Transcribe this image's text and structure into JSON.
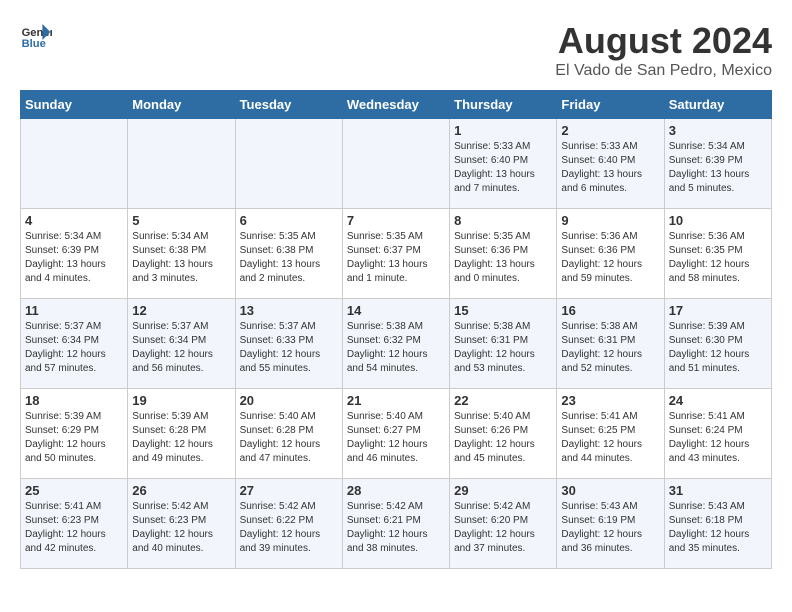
{
  "header": {
    "logo_general": "General",
    "logo_blue": "Blue",
    "month_year": "August 2024",
    "location": "El Vado de San Pedro, Mexico"
  },
  "weekdays": [
    "Sunday",
    "Monday",
    "Tuesday",
    "Wednesday",
    "Thursday",
    "Friday",
    "Saturday"
  ],
  "weeks": [
    [
      {
        "day": "",
        "info": ""
      },
      {
        "day": "",
        "info": ""
      },
      {
        "day": "",
        "info": ""
      },
      {
        "day": "",
        "info": ""
      },
      {
        "day": "1",
        "info": "Sunrise: 5:33 AM\nSunset: 6:40 PM\nDaylight: 13 hours\nand 7 minutes."
      },
      {
        "day": "2",
        "info": "Sunrise: 5:33 AM\nSunset: 6:40 PM\nDaylight: 13 hours\nand 6 minutes."
      },
      {
        "day": "3",
        "info": "Sunrise: 5:34 AM\nSunset: 6:39 PM\nDaylight: 13 hours\nand 5 minutes."
      }
    ],
    [
      {
        "day": "4",
        "info": "Sunrise: 5:34 AM\nSunset: 6:39 PM\nDaylight: 13 hours\nand 4 minutes."
      },
      {
        "day": "5",
        "info": "Sunrise: 5:34 AM\nSunset: 6:38 PM\nDaylight: 13 hours\nand 3 minutes."
      },
      {
        "day": "6",
        "info": "Sunrise: 5:35 AM\nSunset: 6:38 PM\nDaylight: 13 hours\nand 2 minutes."
      },
      {
        "day": "7",
        "info": "Sunrise: 5:35 AM\nSunset: 6:37 PM\nDaylight: 13 hours\nand 1 minute."
      },
      {
        "day": "8",
        "info": "Sunrise: 5:35 AM\nSunset: 6:36 PM\nDaylight: 13 hours\nand 0 minutes."
      },
      {
        "day": "9",
        "info": "Sunrise: 5:36 AM\nSunset: 6:36 PM\nDaylight: 12 hours\nand 59 minutes."
      },
      {
        "day": "10",
        "info": "Sunrise: 5:36 AM\nSunset: 6:35 PM\nDaylight: 12 hours\nand 58 minutes."
      }
    ],
    [
      {
        "day": "11",
        "info": "Sunrise: 5:37 AM\nSunset: 6:34 PM\nDaylight: 12 hours\nand 57 minutes."
      },
      {
        "day": "12",
        "info": "Sunrise: 5:37 AM\nSunset: 6:34 PM\nDaylight: 12 hours\nand 56 minutes."
      },
      {
        "day": "13",
        "info": "Sunrise: 5:37 AM\nSunset: 6:33 PM\nDaylight: 12 hours\nand 55 minutes."
      },
      {
        "day": "14",
        "info": "Sunrise: 5:38 AM\nSunset: 6:32 PM\nDaylight: 12 hours\nand 54 minutes."
      },
      {
        "day": "15",
        "info": "Sunrise: 5:38 AM\nSunset: 6:31 PM\nDaylight: 12 hours\nand 53 minutes."
      },
      {
        "day": "16",
        "info": "Sunrise: 5:38 AM\nSunset: 6:31 PM\nDaylight: 12 hours\nand 52 minutes."
      },
      {
        "day": "17",
        "info": "Sunrise: 5:39 AM\nSunset: 6:30 PM\nDaylight: 12 hours\nand 51 minutes."
      }
    ],
    [
      {
        "day": "18",
        "info": "Sunrise: 5:39 AM\nSunset: 6:29 PM\nDaylight: 12 hours\nand 50 minutes."
      },
      {
        "day": "19",
        "info": "Sunrise: 5:39 AM\nSunset: 6:28 PM\nDaylight: 12 hours\nand 49 minutes."
      },
      {
        "day": "20",
        "info": "Sunrise: 5:40 AM\nSunset: 6:28 PM\nDaylight: 12 hours\nand 47 minutes."
      },
      {
        "day": "21",
        "info": "Sunrise: 5:40 AM\nSunset: 6:27 PM\nDaylight: 12 hours\nand 46 minutes."
      },
      {
        "day": "22",
        "info": "Sunrise: 5:40 AM\nSunset: 6:26 PM\nDaylight: 12 hours\nand 45 minutes."
      },
      {
        "day": "23",
        "info": "Sunrise: 5:41 AM\nSunset: 6:25 PM\nDaylight: 12 hours\nand 44 minutes."
      },
      {
        "day": "24",
        "info": "Sunrise: 5:41 AM\nSunset: 6:24 PM\nDaylight: 12 hours\nand 43 minutes."
      }
    ],
    [
      {
        "day": "25",
        "info": "Sunrise: 5:41 AM\nSunset: 6:23 PM\nDaylight: 12 hours\nand 42 minutes."
      },
      {
        "day": "26",
        "info": "Sunrise: 5:42 AM\nSunset: 6:23 PM\nDaylight: 12 hours\nand 40 minutes."
      },
      {
        "day": "27",
        "info": "Sunrise: 5:42 AM\nSunset: 6:22 PM\nDaylight: 12 hours\nand 39 minutes."
      },
      {
        "day": "28",
        "info": "Sunrise: 5:42 AM\nSunset: 6:21 PM\nDaylight: 12 hours\nand 38 minutes."
      },
      {
        "day": "29",
        "info": "Sunrise: 5:42 AM\nSunset: 6:20 PM\nDaylight: 12 hours\nand 37 minutes."
      },
      {
        "day": "30",
        "info": "Sunrise: 5:43 AM\nSunset: 6:19 PM\nDaylight: 12 hours\nand 36 minutes."
      },
      {
        "day": "31",
        "info": "Sunrise: 5:43 AM\nSunset: 6:18 PM\nDaylight: 12 hours\nand 35 minutes."
      }
    ]
  ]
}
